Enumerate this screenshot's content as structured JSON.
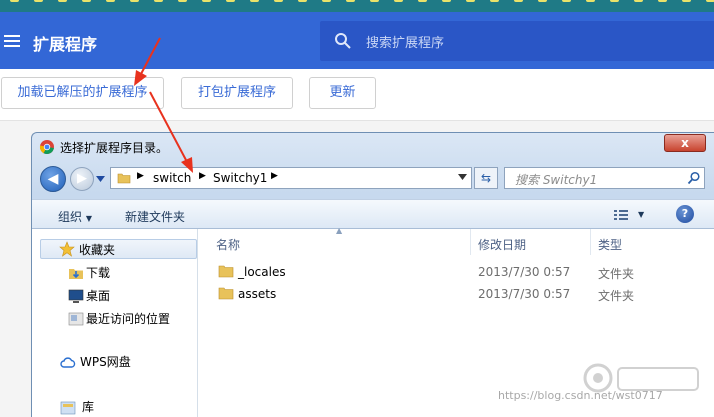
{
  "header": {
    "title": "扩展程序",
    "search_placeholder": "搜索扩展程序",
    "color": "#3367d6"
  },
  "toolbar": {
    "load_unpacked": "加载已解压的扩展程序",
    "pack": "打包扩展程序",
    "update": "更新"
  },
  "dialog": {
    "title": "选择扩展程序目录。",
    "close_label": "x",
    "breadcrumb": [
      "switch",
      "Switchy1"
    ],
    "search_placeholder": "搜索 Switchy1",
    "commands": {
      "organize": "组织",
      "new_folder": "新建文件夹"
    },
    "nav": {
      "favorites": "收藏夹",
      "downloads": "下载",
      "desktop": "桌面",
      "recent": "最近访问的位置",
      "wps": "WPS网盘",
      "library": "库"
    },
    "columns": {
      "name": "名称",
      "modified": "修改日期",
      "type": "类型"
    },
    "files": [
      {
        "name": "_locales",
        "modified": "2013/7/30 0:57",
        "type": "文件夹"
      },
      {
        "name": "assets",
        "modified": "2013/7/30 0:57",
        "type": "文件夹"
      }
    ]
  },
  "watermark": {
    "text": "https://blog.csdn.net/wst0717"
  },
  "annotation_color": "#e8321e"
}
